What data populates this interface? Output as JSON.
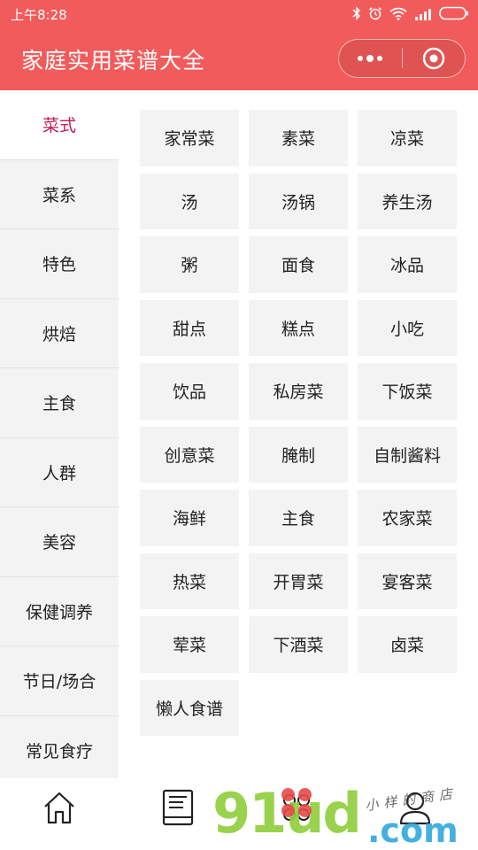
{
  "status_bar": {
    "time": "上午8:28"
  },
  "title_bar": {
    "title": "家庭实用菜谱大全",
    "more_icon": "more-dots-icon",
    "close_icon": "target-close-icon"
  },
  "sidebar": {
    "active_index": 0,
    "items": [
      {
        "label": "菜式"
      },
      {
        "label": "菜系"
      },
      {
        "label": "特色"
      },
      {
        "label": "烘焙"
      },
      {
        "label": "主食"
      },
      {
        "label": "人群"
      },
      {
        "label": "美容"
      },
      {
        "label": "保健调养"
      },
      {
        "label": "节日/场合"
      },
      {
        "label": "常见食疗"
      }
    ]
  },
  "categories": [
    "家常菜",
    "素菜",
    "凉菜",
    "汤",
    "汤锅",
    "养生汤",
    "粥",
    "面食",
    "冰品",
    "甜点",
    "糕点",
    "小吃",
    "饮品",
    "私房菜",
    "下饭菜",
    "创意菜",
    "腌制",
    "自制酱料",
    "海鲜",
    "主食",
    "农家菜",
    "热菜",
    "开胃菜",
    "宴客菜",
    "荤菜",
    "下酒菜",
    "卤菜",
    "懒人食谱"
  ],
  "tab_bar": {
    "tabs": [
      {
        "icon": "home-icon"
      },
      {
        "icon": "note-icon"
      },
      {
        "icon": "grid-icon"
      },
      {
        "icon": "user-icon"
      }
    ]
  },
  "watermark": {
    "brand": "91ud",
    "suffix": ".com",
    "signature": "小样的商店"
  },
  "colors": {
    "accent": "#f25b5b",
    "active_text": "#c2185b",
    "tile_bg": "#f3f3f3"
  }
}
